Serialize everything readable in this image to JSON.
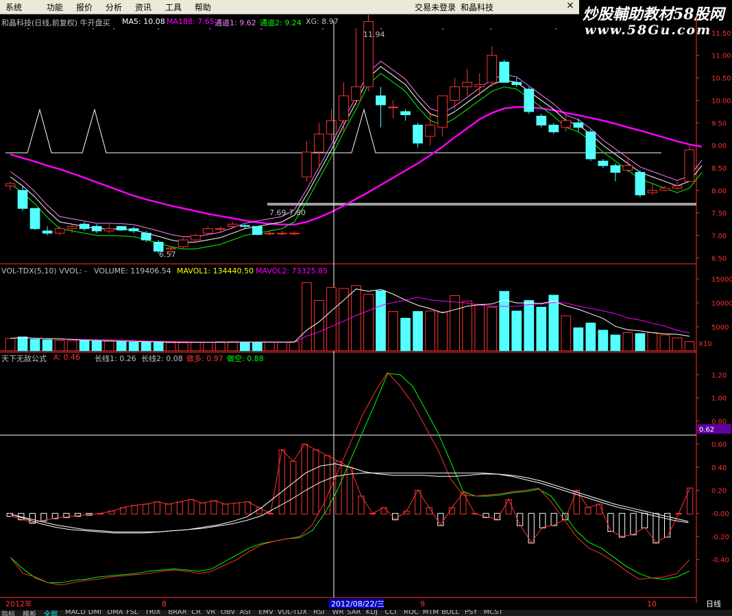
{
  "menu": {
    "items": [
      "系统",
      "功能",
      "报价",
      "分析",
      "资讯",
      "工具",
      "帮助"
    ],
    "status_login": "交易未登录",
    "status_name": "和晶科技",
    "close": "×"
  },
  "watermark": {
    "line1": "炒股輔助教材58股网",
    "line2": "www.58Gu.com"
  },
  "price_panel": {
    "title": "和晶科技(日线,前复权) 牛开盘买",
    "ma5": "MA5: 10.08",
    "ma188": "MA188: 7.65",
    "tongdao1": "通道1: 9.62",
    "tongdao2": "通道2: 9.24",
    "xg": "XG: 8.97",
    "annot_high": "11.94",
    "annot_low": "6.57",
    "annot_range": "7.69-7.80",
    "yticks": [
      "11.50",
      "11.00",
      "10.50",
      "10.00",
      "9.50",
      "9.00",
      "8.50",
      "8.00",
      "7.50",
      "7.00",
      "6.50"
    ]
  },
  "vol_panel": {
    "title": "VOL-TDX(5,10) VVOL: -",
    "volume": "VOLUME: 119406.54",
    "mavol1": "MAVOL1: 134440.50",
    "mavol2": "MAVOL2: 73325.85",
    "yticks": [
      "15000",
      "10000",
      "5000"
    ],
    "unit": "X10"
  },
  "ind_panel": {
    "title": "天下无敌公式",
    "a": "A: 0.46",
    "cx1": "长线1: 0.26",
    "cx2": "长线2: 0.08",
    "dd": "做多: 0.97",
    "dk": "做空: 0.88",
    "yticks": [
      "1.20",
      "1.00",
      "0.80",
      "0.60",
      "0.40",
      "0.20",
      "-0.00",
      "-0.20",
      "-0.40"
    ],
    "cursor_value": "0.62"
  },
  "xaxis": {
    "labels": [
      "2012年",
      "8",
      "2012/08/22/三",
      "9",
      "10"
    ],
    "period": "日线"
  },
  "bottom_tabs": [
    "指标",
    "模板",
    "全部",
    "MACD",
    "DMI",
    "DMA",
    "FSL",
    "TRIX",
    "BRAR",
    "CR",
    "VR",
    "OBV",
    "ASI",
    "EMV",
    "VOL-TDX",
    "RSI",
    "WR",
    "SAR",
    "KDJ",
    "CCI",
    "ROC",
    "MTM",
    "BOLL",
    "PSY",
    "MCST"
  ],
  "colors": {
    "up": "#ff3232",
    "down": "#54ffff",
    "ma5": "#ffffff",
    "ma188": "#ff00ff",
    "td1": "#ff80ff",
    "td2": "#00ff00",
    "grid": "#800000",
    "axis": "#ff3232"
  },
  "chart_data": {
    "type": "candlestick",
    "candles": [
      [
        8.1,
        8.2,
        8.0,
        8.15
      ],
      [
        8.0,
        8.1,
        7.55,
        7.6
      ],
      [
        7.6,
        7.6,
        7.12,
        7.15
      ],
      [
        7.1,
        7.2,
        7.0,
        7.05
      ],
      [
        7.05,
        7.2,
        7.0,
        7.15
      ],
      [
        7.15,
        7.25,
        7.05,
        7.2
      ],
      [
        7.25,
        7.3,
        7.1,
        7.15
      ],
      [
        7.2,
        7.25,
        7.05,
        7.1
      ],
      [
        7.1,
        7.25,
        7.05,
        7.15
      ],
      [
        7.2,
        7.2,
        7.1,
        7.12
      ],
      [
        7.15,
        7.2,
        7.05,
        7.1
      ],
      [
        7.05,
        7.1,
        6.85,
        6.9
      ],
      [
        6.85,
        6.9,
        6.6,
        6.65
      ],
      [
        6.7,
        6.75,
        6.57,
        6.72
      ],
      [
        6.75,
        6.95,
        6.7,
        6.9
      ],
      [
        6.9,
        7.05,
        6.85,
        7.0
      ],
      [
        7.05,
        7.2,
        7.0,
        7.15
      ],
      [
        7.15,
        7.2,
        7.05,
        7.15
      ],
      [
        7.2,
        7.3,
        7.15,
        7.25
      ],
      [
        7.22,
        7.25,
        7.15,
        7.2
      ],
      [
        7.2,
        7.2,
        7.0,
        7.02
      ],
      [
        7.05,
        7.1,
        7.0,
        7.05
      ],
      [
        7.05,
        7.1,
        7.0,
        7.05
      ],
      [
        7.05,
        7.1,
        7.0,
        7.05
      ],
      [
        8.3,
        9.1,
        8.2,
        8.85
      ],
      [
        8.85,
        9.5,
        8.5,
        9.25
      ],
      [
        9.25,
        9.8,
        9.1,
        9.55
      ],
      [
        9.55,
        10.4,
        9.3,
        10.1
      ],
      [
        10.0,
        11.6,
        9.9,
        10.3
      ],
      [
        10.3,
        11.94,
        10.2,
        11.75
      ],
      [
        10.1,
        10.3,
        9.4,
        9.9
      ],
      [
        9.85,
        10.0,
        9.6,
        9.85
      ],
      [
        9.75,
        9.8,
        9.55,
        9.68
      ],
      [
        9.45,
        9.5,
        8.95,
        9.05
      ],
      [
        9.2,
        9.7,
        9.0,
        9.45
      ],
      [
        9.4,
        10.1,
        9.2,
        10.1
      ],
      [
        10.0,
        10.5,
        9.8,
        10.3
      ],
      [
        10.3,
        10.7,
        10.1,
        10.4
      ],
      [
        10.3,
        10.6,
        10.1,
        10.35
      ],
      [
        10.4,
        11.2,
        10.3,
        11.0
      ],
      [
        10.85,
        10.9,
        10.4,
        10.4
      ],
      [
        10.4,
        10.5,
        10.3,
        10.35
      ],
      [
        10.25,
        10.3,
        9.7,
        9.75
      ],
      [
        9.65,
        9.7,
        9.4,
        9.45
      ],
      [
        9.45,
        9.5,
        9.25,
        9.3
      ],
      [
        9.4,
        9.7,
        9.3,
        9.55
      ],
      [
        9.5,
        9.6,
        9.3,
        9.4
      ],
      [
        9.3,
        9.35,
        8.65,
        8.7
      ],
      [
        8.65,
        8.7,
        8.5,
        8.55
      ],
      [
        8.55,
        8.6,
        8.2,
        8.4
      ],
      [
        8.45,
        8.7,
        8.4,
        8.55
      ],
      [
        8.4,
        8.45,
        7.85,
        7.9
      ],
      [
        7.95,
        8.15,
        7.9,
        8.0
      ],
      [
        8.0,
        8.1,
        7.98,
        8.05
      ],
      [
        8.05,
        8.2,
        8.0,
        8.1
      ],
      [
        8.2,
        9.0,
        8.2,
        8.9
      ]
    ],
    "volumes": [
      2600,
      2900,
      2400,
      2300,
      2200,
      2100,
      2100,
      2000,
      2000,
      1900,
      1800,
      1800,
      1800,
      1700,
      1700,
      1800,
      1800,
      1900,
      1900,
      1800,
      1800,
      1800,
      1800,
      1900,
      14200,
      10500,
      13200,
      13000,
      13600,
      11800,
      12500,
      8200,
      6800,
      8200,
      8300,
      8100,
      11500,
      10400,
      9700,
      9100,
      12400,
      8300,
      10500,
      9100,
      11600,
      7300,
      4800,
      5800,
      4300,
      3300,
      3800,
      3600,
      3800,
      3300,
      2700,
      1900,
      1700,
      2600,
      2200,
      2000,
      1900,
      1800,
      1900,
      3700
    ],
    "ma5": [
      8.3,
      8.1,
      7.85,
      7.55,
      7.3,
      7.25,
      7.2,
      7.15,
      7.15,
      7.14,
      7.12,
      7.05,
      6.98,
      6.9,
      6.85,
      6.85,
      6.9,
      6.95,
      7.05,
      7.15,
      7.2,
      7.25,
      7.3,
      7.45,
      7.9,
      8.4,
      8.9,
      9.45,
      9.95,
      10.5,
      10.75,
      10.55,
      10.35,
      10.0,
      9.7,
      9.6,
      9.75,
      9.95,
      10.15,
      10.35,
      10.45,
      10.4,
      10.2,
      10.0,
      9.8,
      9.55,
      9.45,
      9.25,
      9.0,
      8.8,
      8.6,
      8.4,
      8.3,
      8.2,
      8.1,
      8.2,
      8.55
    ],
    "ma188": [
      8.8,
      8.72,
      8.64,
      8.55,
      8.47,
      8.38,
      8.28,
      8.18,
      8.08,
      7.98,
      7.88,
      7.8,
      7.73,
      7.66,
      7.6,
      7.54,
      7.48,
      7.43,
      7.38,
      7.33,
      7.29,
      7.26,
      7.24,
      7.24,
      7.3,
      7.4,
      7.52,
      7.66,
      7.81,
      7.96,
      8.12,
      8.28,
      8.44,
      8.6,
      8.78,
      8.97,
      9.18,
      9.38,
      9.58,
      9.72,
      9.82,
      9.85,
      9.85,
      9.82,
      9.78,
      9.72,
      9.67,
      9.61,
      9.55,
      9.48,
      9.4,
      9.33,
      9.25,
      9.17,
      9.09,
      9.02,
      8.97
    ],
    "ind_a": [
      -0.02,
      -0.05,
      -0.08,
      -0.06,
      -0.04,
      -0.03,
      -0.02,
      -0.01,
      0.0,
      0.02,
      0.05,
      0.07,
      0.08,
      0.1,
      0.08,
      0.1,
      0.12,
      0.09,
      0.11,
      0.08,
      0.09,
      0.1,
      0.05,
      0.0,
      0.55,
      0.45,
      0.6,
      0.55,
      0.5,
      0.45,
      0.4,
      0.15,
      0.0,
      0.05,
      -0.05,
      0.02,
      0.2,
      0.05,
      -0.1,
      0.05,
      0.18,
      0.0,
      -0.03,
      -0.05,
      0.12,
      -0.1,
      -0.25,
      -0.12,
      -0.1,
      -0.05,
      0.2,
      0.05,
      0.08,
      -0.15,
      -0.2,
      -0.18,
      -0.12,
      -0.25,
      -0.2,
      0.0,
      0.22
    ],
    "ind_dd": [
      -0.38,
      -0.52,
      -0.55,
      -0.6,
      -0.62,
      -0.6,
      -0.58,
      -0.57,
      -0.55,
      -0.54,
      -0.53,
      -0.52,
      -0.5,
      -0.49,
      -0.5,
      -0.52,
      -0.5,
      -0.45,
      -0.4,
      -0.33,
      -0.27,
      -0.24,
      -0.22,
      -0.2,
      -0.1,
      0.1,
      0.35,
      0.6,
      0.85,
      1.05,
      1.22,
      1.1,
      0.95,
      0.75,
      0.55,
      0.3,
      0.16,
      0.15,
      0.16,
      0.17,
      0.19,
      0.2,
      0.22,
      0.1,
      -0.05,
      -0.2,
      -0.3,
      -0.35,
      -0.42,
      -0.5,
      -0.57,
      -0.56,
      -0.55,
      -0.52,
      -0.4
    ],
    "ind_dk": [
      -0.38,
      -0.48,
      -0.56,
      -0.6,
      -0.6,
      -0.58,
      -0.57,
      -0.55,
      -0.54,
      -0.53,
      -0.52,
      -0.5,
      -0.49,
      -0.48,
      -0.49,
      -0.5,
      -0.48,
      -0.42,
      -0.36,
      -0.3,
      -0.26,
      -0.24,
      -0.22,
      -0.21,
      -0.15,
      0.0,
      0.2,
      0.45,
      0.7,
      0.95,
      1.21,
      1.2,
      1.1,
      0.9,
      0.7,
      0.45,
      0.19,
      0.15,
      0.15,
      0.16,
      0.18,
      0.19,
      0.21,
      0.15,
      0.0,
      -0.15,
      -0.25,
      -0.3,
      -0.38,
      -0.46,
      -0.52,
      -0.56,
      -0.57,
      -0.55,
      -0.5
    ],
    "ind_cx1": [
      -0.01,
      -0.05,
      -0.09,
      -0.12,
      -0.14,
      -0.15,
      -0.16,
      -0.17,
      -0.17,
      -0.17,
      -0.16,
      -0.15,
      -0.14,
      -0.12,
      -0.1,
      -0.07,
      -0.03,
      0.05,
      0.15,
      0.25,
      0.35,
      0.41,
      0.43,
      0.4,
      0.36,
      0.34,
      0.33,
      0.33,
      0.33,
      0.32,
      0.32,
      0.33,
      0.34,
      0.34,
      0.33,
      0.31,
      0.28,
      0.24,
      0.2,
      0.16,
      0.12,
      0.08,
      0.05,
      0.02,
      -0.01,
      -0.04,
      -0.07
    ],
    "ind_cx2": [
      -0.01,
      -0.04,
      -0.07,
      -0.1,
      -0.12,
      -0.14,
      -0.15,
      -0.16,
      -0.16,
      -0.16,
      -0.16,
      -0.15,
      -0.14,
      -0.13,
      -0.11,
      -0.09,
      -0.06,
      -0.02,
      0.05,
      0.12,
      0.2,
      0.27,
      0.32,
      0.34,
      0.35,
      0.35,
      0.35,
      0.35,
      0.35,
      0.35,
      0.35,
      0.35,
      0.35,
      0.34,
      0.32,
      0.29,
      0.26,
      0.22,
      0.18,
      0.14,
      0.1,
      0.06,
      0.03,
      0.0,
      -0.03,
      -0.06,
      -0.08
    ]
  }
}
